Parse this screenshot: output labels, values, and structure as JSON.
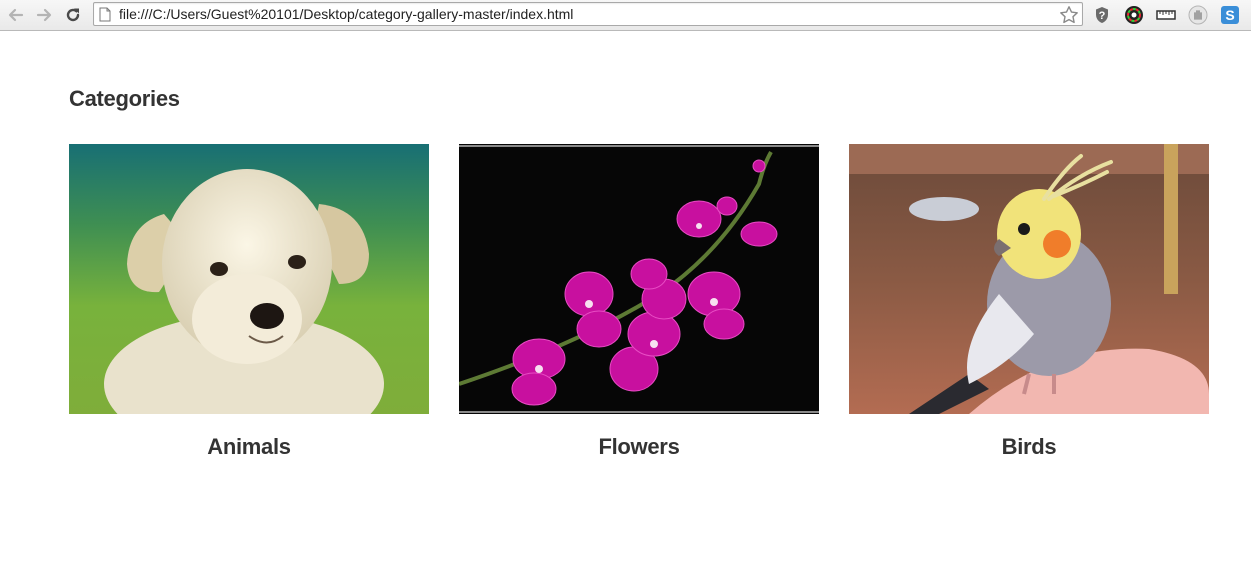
{
  "browser": {
    "url": "file:///C:/Users/Guest%20101/Desktop/category-gallery-master/index.html",
    "icons": {
      "back": "back-arrow-icon",
      "forward": "forward-arrow-icon",
      "reload": "reload-icon",
      "page": "page-icon",
      "bookmark": "star-icon"
    },
    "extensions": [
      "help-icon",
      "color-picker-icon",
      "ruler-icon",
      "stop-hand-icon",
      "skype-icon"
    ]
  },
  "page": {
    "heading": "Categories",
    "categories": [
      {
        "label": "Animals",
        "image": "white puppy on green background"
      },
      {
        "label": "Flowers",
        "image": "magenta orchid on black background"
      },
      {
        "label": "Birds",
        "image": "cockatiel perched on hand"
      }
    ]
  }
}
